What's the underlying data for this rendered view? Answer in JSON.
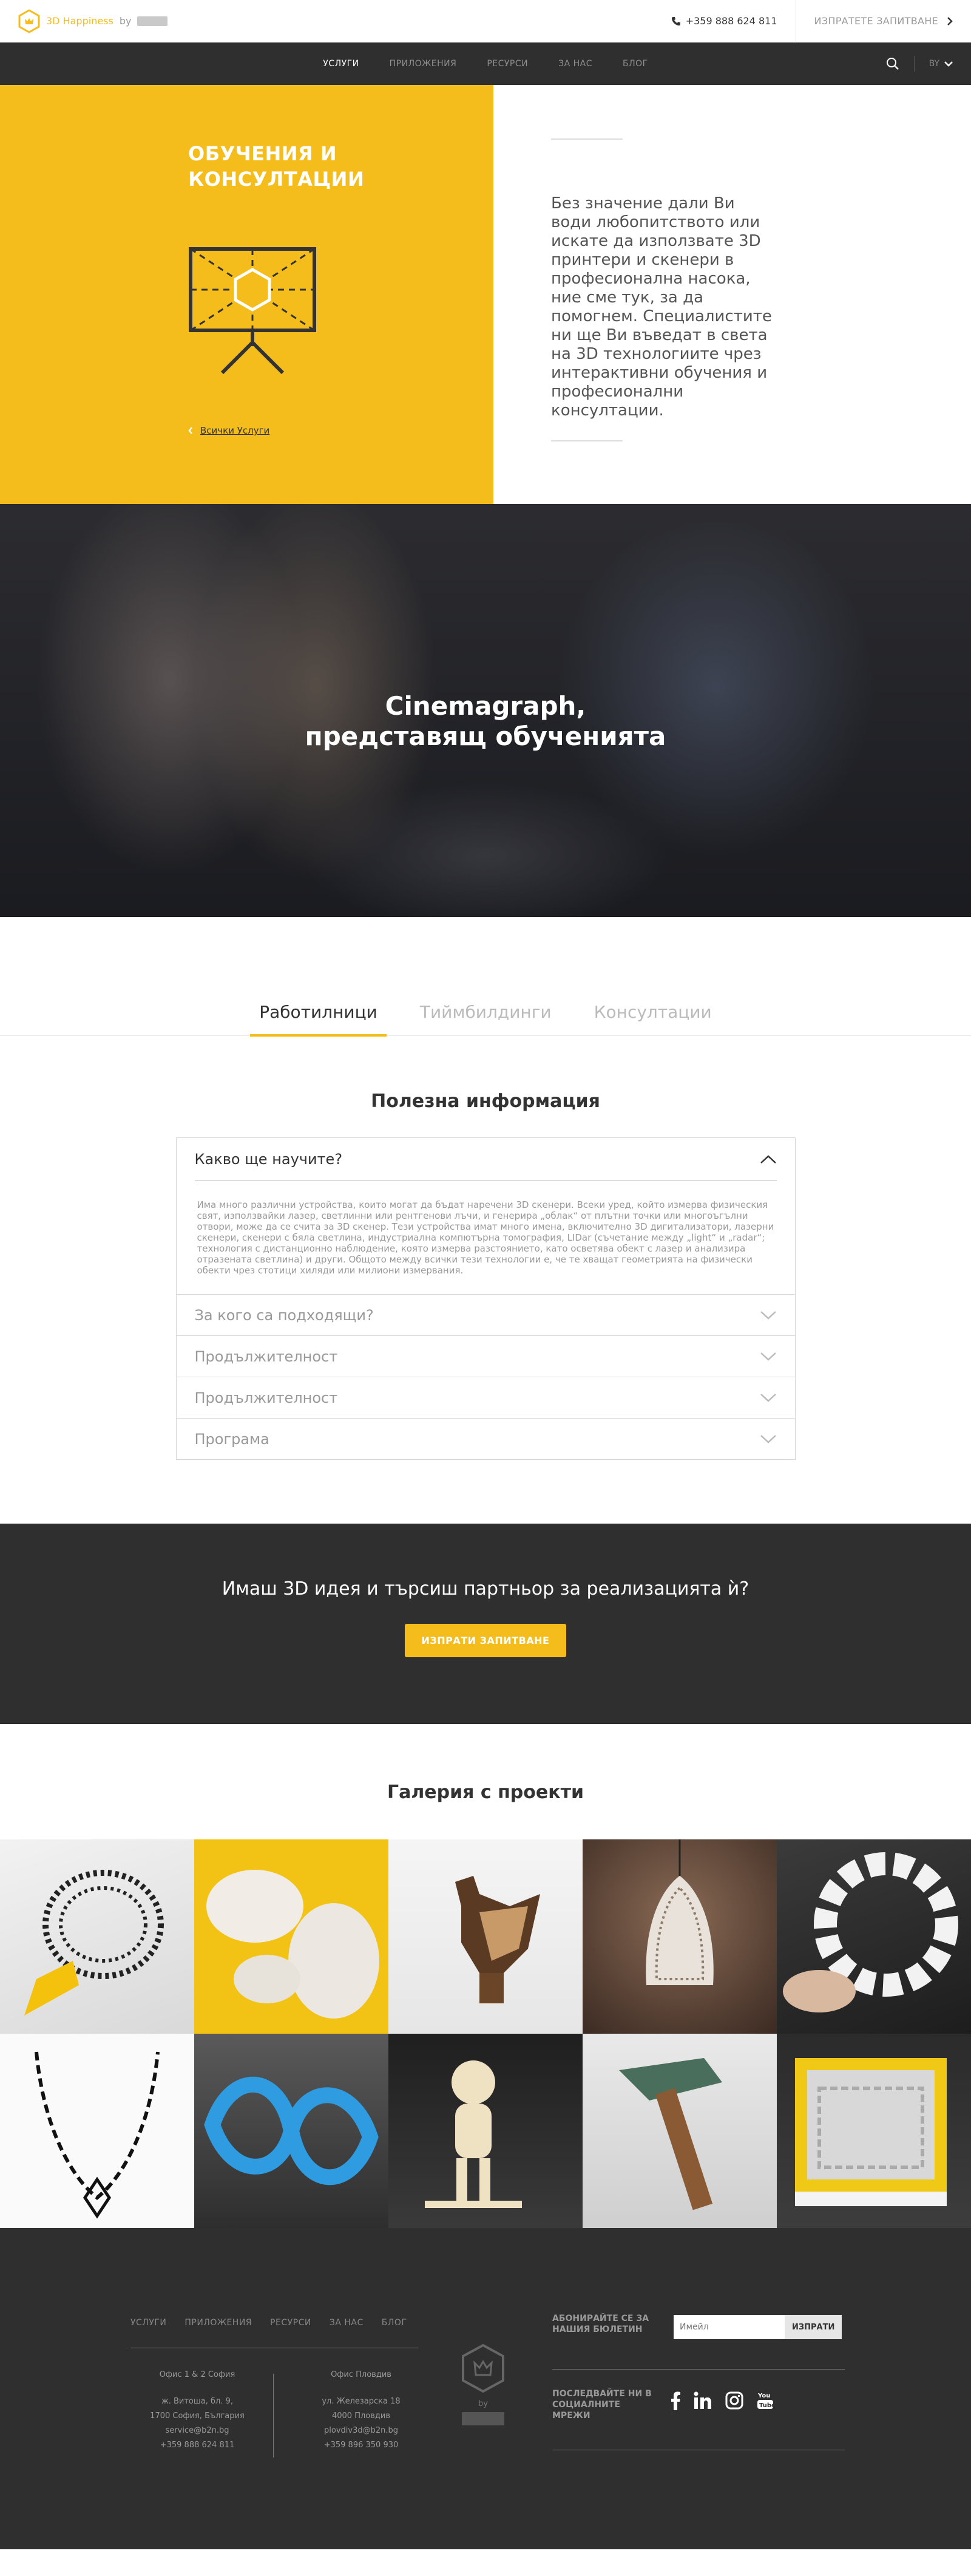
{
  "topbar": {
    "logo_text": "3D Happiness",
    "logo_by": "by",
    "phone": "+359 888 624 811",
    "send_request": "ИЗПРАТЕТЕ ЗАПИТВАНЕ"
  },
  "nav": {
    "items": [
      "УСЛУГИ",
      "ПРИЛОЖЕНИЯ",
      "РЕСУРСИ",
      "ЗА НАС",
      "БЛОГ"
    ],
    "language": "BY"
  },
  "hero": {
    "title_line1": "ОБУЧЕНИЯ И",
    "title_line2": "КОНСУЛТАЦИИ",
    "all_services": "Всички Услуги",
    "description": "Без значение дали Ви води любопитството или искате да използвате 3D принтери и скенери в професионална насока, ние сме тук, за да помогнем. Специалистите ни ще Ви въведат в света на 3D технологиите чрез интерактивни обучения и професионални консултации."
  },
  "cinemagraph": {
    "line1": "Cinemagraph,",
    "line2": "представящ обученията"
  },
  "tabs": [
    "Работилници",
    "Тиймбилдинги",
    "Консултации"
  ],
  "info": {
    "title": "Полезна информация",
    "open_question": "Какво ще научите?",
    "open_answer": "Има много различни устройства, които могат да бъдат наречени 3D скенери. Всеки уред, който измерва физическия свят, използвайки лазер, светлинни или рентгенови лъчи, и генерира „облак“ от плътни точки или многоъгълни отвори, може да се счита за 3D скенер. Тези устройства имат много имена, включително 3D дигитализатори, лазерни скенери, скенери с бяла светлина, индустриална компютърна томография, LIDar (съчетание между „light“ и „radar“; технология с дистанционно наблюдение, която измерва разстоянието, като осветява обект с лазер и анализира отразената светлина) и други. Общото между всички тези технологии е, че те хващат геометрията на физически обекти чрез стотици хиляди или милиони измервания.",
    "questions": [
      "За кого са подходящи?",
      "Продължителност",
      "Продължителност",
      "Програма"
    ]
  },
  "cta": {
    "text": "Имаш 3D идея и търсиш партньор за реализацията ѝ?",
    "button": "ИЗПРАТИ ЗАПИТВАНЕ"
  },
  "gallery": {
    "title": "Галерия с проекти"
  },
  "footer": {
    "nav": [
      "УСЛУГИ",
      "ПРИЛОЖЕНИЯ",
      "РЕСУРСИ",
      "ЗА НАС",
      "БЛОГ"
    ],
    "office_sofia": {
      "title": "Офис 1 & 2 София",
      "address": "ж. Витоша, бл. 9,",
      "city": "1700 София, България",
      "email": "service@b2n.bg",
      "phone": "+359 888 624 811"
    },
    "office_plovdiv": {
      "title": "Офис Пловдив",
      "address": "ул. Железарска 18",
      "city": "4000 Пловдив",
      "email": "plovdiv3d@b2n.bg",
      "phone": "+359 896 350 930"
    },
    "brand_by": "by",
    "subscribe": "АБОНИРАЙТЕ СЕ ЗА НАШИЯ БЮЛЕТИН",
    "email_placeholder": "Имейл",
    "send": "ИЗПРАТИ",
    "follow": "ПОСЛЕДВАЙТЕ НИ В СОЦИАЛНИТЕ МРЕЖИ",
    "social": [
      "facebook-icon",
      "linkedin-icon",
      "instagram-icon",
      "youtube-icon"
    ]
  },
  "colors": {
    "accent": "#f4bd1b",
    "dark": "#2f2f2f"
  }
}
